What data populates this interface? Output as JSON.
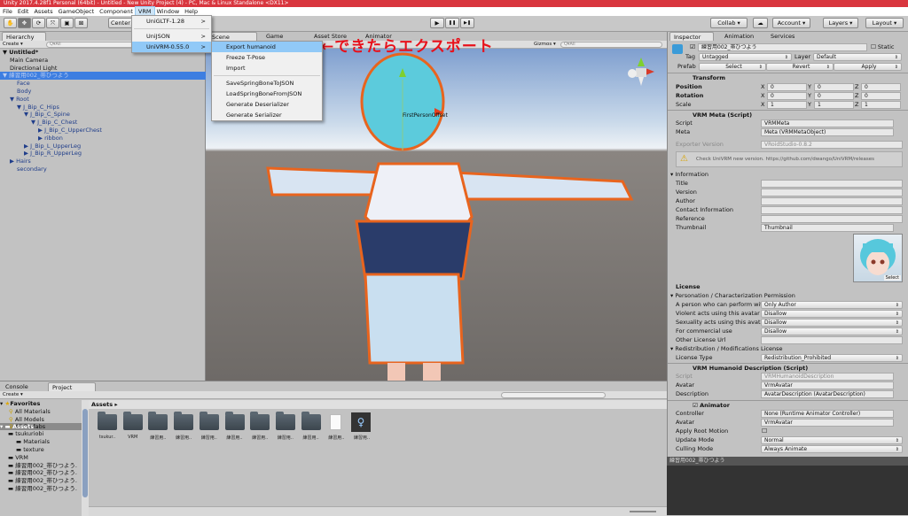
{
  "window": {
    "title": "Unity 2017.4.28f1 Personal (64bit) - Untitled - New Unity Project (4) - PC, Mac & Linux Standalone <DX11>"
  },
  "menubar": [
    "File",
    "Edit",
    "Assets",
    "GameObject",
    "Component",
    "VRM",
    "Window",
    "Help"
  ],
  "toolbar": {
    "center": "Center",
    "collab": "Collab ▾",
    "account": "Account ▾",
    "layers": "Layers ▾",
    "layout": "Layout ▾",
    "play": "▶",
    "pause": "❚❚",
    "step": "▶❚"
  },
  "vrm_menu": {
    "items": [
      "UniGLTF-1.28",
      "UniJSON",
      "UniVRM-0.55.0"
    ],
    "arrow": ">"
  },
  "univrm_submenu": [
    "Export humanoid",
    "Freeze T-Pose",
    "Import",
    "SaveSpringBoneToJSON",
    "LoadSpringBoneFromJSON",
    "Generate Deserializer",
    "Generate Serializer"
  ],
  "annotation": {
    "text": "←できたらエクスポート",
    "color": "#e8101a"
  },
  "hierarchy": {
    "tab": "Hierarchy",
    "create": "Create ▾",
    "search_placeholder": "Q▾All",
    "items": [
      {
        "label": "Untitled*",
        "depth": 0,
        "arrow": "▼"
      },
      {
        "label": "Main Camera",
        "depth": 1,
        "arrow": ""
      },
      {
        "label": "Directional Light",
        "depth": 1,
        "arrow": ""
      },
      {
        "label": "練習用002_帯ひつよう",
        "depth": 0,
        "arrow": "▼"
      },
      {
        "label": "Face",
        "depth": 2,
        "arrow": ""
      },
      {
        "label": "Body",
        "depth": 2,
        "arrow": ""
      },
      {
        "label": "Root",
        "depth": 1,
        "arrow": "▼"
      },
      {
        "label": "J_Bip_C_Hips",
        "depth": 2,
        "arrow": "▼"
      },
      {
        "label": "J_Bip_C_Spine",
        "depth": 3,
        "arrow": "▼"
      },
      {
        "label": "J_Bip_C_Chest",
        "depth": 4,
        "arrow": "▼"
      },
      {
        "label": "J_Bip_C_UpperChest",
        "depth": 5,
        "arrow": "▶"
      },
      {
        "label": "ribbon",
        "depth": 5,
        "arrow": "▶"
      },
      {
        "label": "J_Bip_L_UpperLeg",
        "depth": 3,
        "arrow": "▶"
      },
      {
        "label": "J_Bip_R_UpperLeg",
        "depth": 3,
        "arrow": "▶"
      },
      {
        "label": "Hairs",
        "depth": 1,
        "arrow": "▶"
      },
      {
        "label": "secondary",
        "depth": 2,
        "arrow": ""
      }
    ]
  },
  "scene": {
    "tabs": [
      "Scene",
      "Game",
      "Asset Store",
      "Animator"
    ],
    "gizmos": "Gizmos ▾",
    "search_placeholder": "Q▾All",
    "label": "FirstPersonOffset"
  },
  "inspector": {
    "tabs": [
      "Inspector",
      "Animation",
      "Services"
    ],
    "object_name": "練習用002_帯ひつよう",
    "static": "Static",
    "tag_label": "Tag",
    "tag": "Untagged",
    "layer_label": "Layer",
    "layer": "Default",
    "prefab_label": "Prefab",
    "prefab_buttons": [
      "Select",
      "Revert",
      "Apply"
    ],
    "transform": {
      "title": "Transform",
      "rows": [
        {
          "label": "Position",
          "x": "0",
          "y": "0",
          "z": "0"
        },
        {
          "label": "Rotation",
          "x": "0",
          "y": "0",
          "z": "0"
        },
        {
          "label": "Scale",
          "x": "1",
          "y": "1",
          "z": "1"
        }
      ]
    },
    "vrm_meta": {
      "title": "VRM Meta (Script)",
      "script_label": "Script",
      "script": "VRMMeta",
      "meta_label": "Meta",
      "meta": "Meta (VRMMetaObject)",
      "exporter_label": "Exporter Version",
      "exporter": "VRoidStudio-0.8.2",
      "warning": "Check UniVRM new version. https://github.com/dwango/UniVRM/releases",
      "information": "Information",
      "info_fields": [
        "Title",
        "Version",
        "Author",
        "Contact Information",
        "Reference"
      ],
      "thumbnail_label": "Thumbnail",
      "thumbnail": "Thumbnail",
      "select": "Select",
      "license": "License",
      "perm_header": "Personation / Characterization Permission",
      "perm_rows": [
        {
          "label": "A person who can perform wit",
          "value": "Only Author"
        },
        {
          "label": "Violent acts using this avatar",
          "value": "Disallow"
        },
        {
          "label": "Sexuality acts using this avata",
          "value": "Disallow"
        },
        {
          "label": "For commercial use",
          "value": "Disallow"
        }
      ],
      "other_license": "Other License Url",
      "redist_header": "Redistribution / Modifications License",
      "license_type_label": "License Type",
      "license_type": "Redistribution_Prohibited"
    },
    "humanoid": {
      "title": "VRM Humanoid Description (Script)",
      "script_label": "Script",
      "script": "VRMHumanoidDescription",
      "avatar_label": "Avatar",
      "avatar": "VrmAvatar",
      "desc_label": "Description",
      "desc": "AvatarDescription (AvatarDescription)"
    },
    "animator": {
      "title": "Animator",
      "controller_label": "Controller",
      "controller": "None (Runtime Animator Controller)",
      "avatar_label": "Avatar",
      "avatar": "VrmAvatar",
      "root_motion": "Apply Root Motion",
      "update_label": "Update Mode",
      "update": "Normal",
      "culling_label": "Culling Mode",
      "culling": "Always Animate"
    },
    "preview_title": "練習用002_帯ひつよう"
  },
  "bottom": {
    "tabs": [
      "Console",
      "Project"
    ],
    "create": "Create ▾",
    "favorites": {
      "title": "Favorites",
      "items": [
        "All Materials",
        "All Models",
        "All Prefabs"
      ]
    },
    "assets_tree": {
      "title": "Assets",
      "items": [
        {
          "label": "tsukuriobi",
          "depth": 1
        },
        {
          "label": "Materials",
          "depth": 2
        },
        {
          "label": "texture",
          "depth": 2
        },
        {
          "label": "VRM",
          "depth": 1
        },
        {
          "label": "練習用002_帯ひつよう.",
          "depth": 1
        },
        {
          "label": "練習用002_帯ひつよう.",
          "depth": 1
        },
        {
          "label": "練習用002_帯ひつよう.",
          "depth": 1
        },
        {
          "label": "練習用002_帯ひつよう.",
          "depth": 1
        }
      ]
    },
    "breadcrumb": "Assets ▸",
    "assets": [
      "tsukur..",
      "VRM",
      "練習用..",
      "練習用..",
      "練習用..",
      "練習用..",
      "練習用..",
      "練習用..",
      "練習用..",
      "練習用..",
      "練習用.."
    ]
  }
}
